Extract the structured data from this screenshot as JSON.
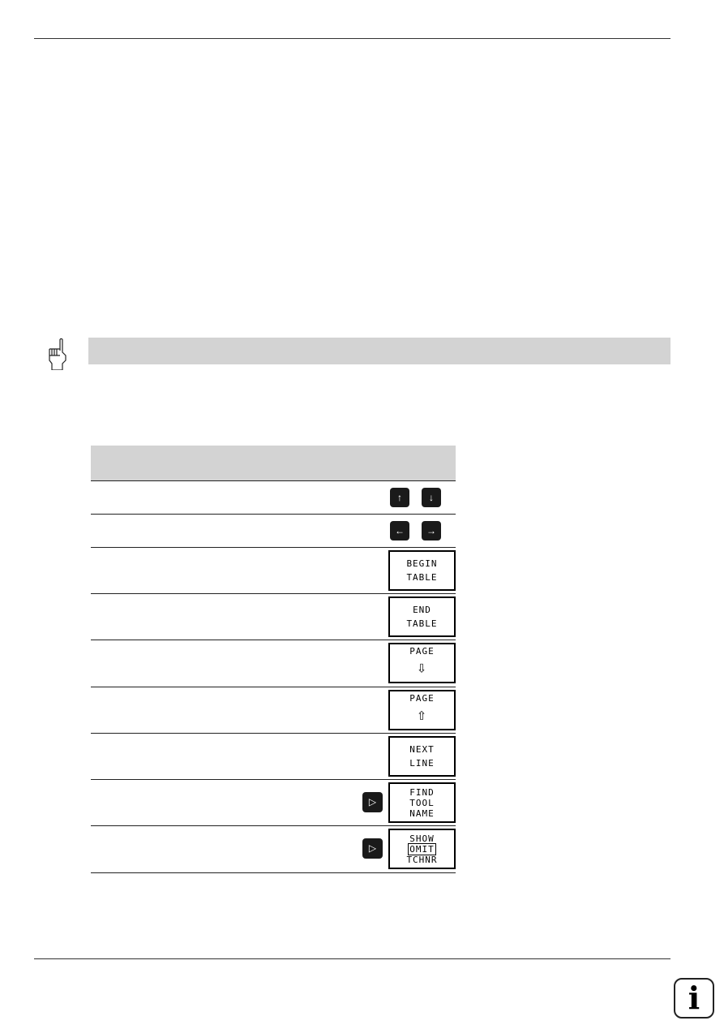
{
  "keys": {
    "row1": [
      "↑",
      "↓"
    ],
    "row2": [
      "←",
      "→"
    ],
    "next_arrow": "▷"
  },
  "softkeys": [
    {
      "line1": "BEGIN",
      "line2": "TABLE"
    },
    {
      "line1": "END",
      "line2": "TABLE"
    },
    {
      "line1": "PAGE",
      "line2": "⇩"
    },
    {
      "line1": "PAGE",
      "line2": "⇧"
    },
    {
      "line1": "NEXT",
      "line2": "LINE"
    },
    {
      "line1": "FIND",
      "line2": "TOOL",
      "line3": "NAME"
    },
    {
      "line1": "SHOW",
      "line2": "OMIT",
      "line3": "TCHNR"
    }
  ],
  "info_icon": "i"
}
